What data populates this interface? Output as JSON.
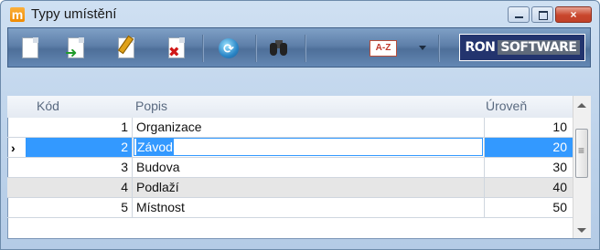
{
  "window": {
    "title": "Typy umístění",
    "app_icon_letter": "m",
    "controls": {
      "minimize": "minimize",
      "maximize": "maximize",
      "close": "×"
    }
  },
  "toolbar": {
    "buttons": [
      {
        "name": "new-document-icon"
      },
      {
        "name": "open-document-icon"
      },
      {
        "name": "edit-document-icon"
      },
      {
        "name": "delete-document-icon"
      },
      {
        "name": "refresh-icon"
      },
      {
        "name": "find-binoculars-icon"
      },
      {
        "name": "sort-az-icon",
        "label": "A-Z"
      }
    ],
    "brand": {
      "part1": "RON",
      "part2": "SOFTWARE"
    }
  },
  "grid": {
    "columns": [
      "Kód",
      "Popis",
      "Úroveň"
    ],
    "rows": [
      {
        "kod": "1",
        "popis": "Organizace",
        "uroven": "10"
      },
      {
        "kod": "2",
        "popis": "Závod",
        "uroven": "20"
      },
      {
        "kod": "3",
        "popis": "Budova",
        "uroven": "30"
      },
      {
        "kod": "4",
        "popis": "Podlaží",
        "uroven": "40"
      },
      {
        "kod": "5",
        "popis": "Místnost",
        "uroven": "50"
      }
    ],
    "selected_row": 2,
    "row_pointer": "›"
  },
  "colors": {
    "selection": "#3399ff",
    "brand_bg": "#23346e"
  }
}
